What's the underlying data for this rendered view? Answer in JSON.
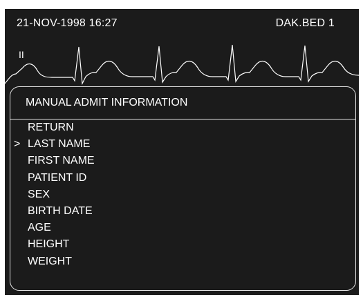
{
  "header": {
    "datetime": "21-NOV-1998  16:27",
    "bed": "DAK.BED 1"
  },
  "waveform": {
    "lead": "II"
  },
  "menu": {
    "title": "MANUAL ADMIT INFORMATION",
    "cursor": ">",
    "selected_index": 1,
    "items": [
      "RETURN",
      "LAST NAME",
      "FIRST NAME",
      "PATIENT ID",
      "SEX",
      "BIRTH DATE",
      "AGE",
      "HEIGHT",
      "WEIGHT"
    ]
  },
  "colors": {
    "background": "#1b1b1b",
    "foreground": "#ffffff",
    "border": "#e6e6e6"
  }
}
